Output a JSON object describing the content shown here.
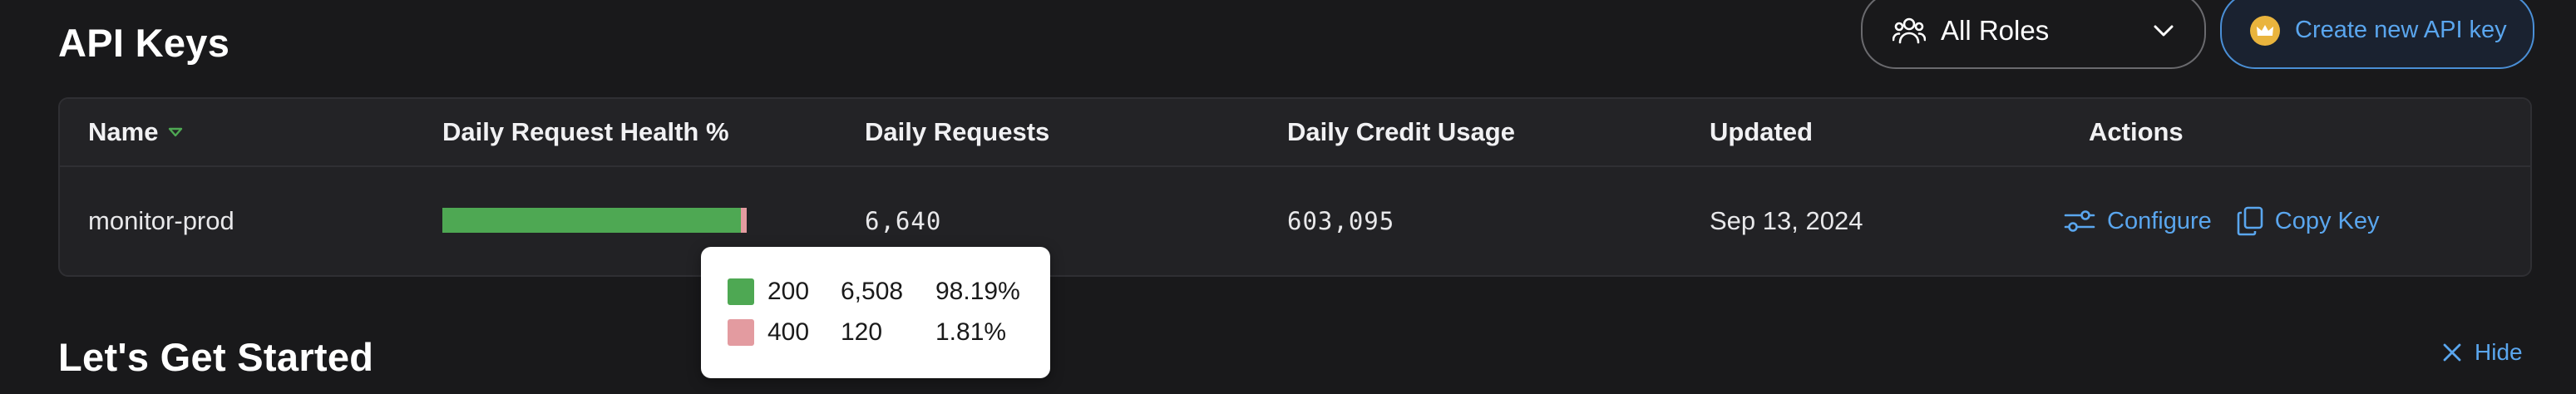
{
  "header": {
    "title": "API Keys",
    "roles_filter": {
      "label": "All Roles",
      "icon": "users-icon"
    },
    "create_button": {
      "label": "Create new API key",
      "icon": "crown-icon"
    }
  },
  "table": {
    "columns": [
      "Name",
      "Daily Request Health %",
      "Daily Requests",
      "Daily Credit Usage",
      "Updated",
      "Actions"
    ],
    "rows": [
      {
        "name": "monitor-prod",
        "health": {
          "ok_fraction": 0.9819,
          "error_fraction": 0.0181
        },
        "daily_requests": "6,640",
        "daily_credit_usage": "603,095",
        "updated": "Sep 13, 2024",
        "actions": {
          "configure": "Configure",
          "copy_key": "Copy Key"
        }
      }
    ]
  },
  "tooltip": {
    "rows": [
      {
        "code": "200",
        "count": "6,508",
        "percent": "98.19%",
        "color": "#4ea853"
      },
      {
        "code": "400",
        "count": "120",
        "percent": "1.81%",
        "color": "#e39ba0"
      }
    ]
  },
  "getting_started": {
    "title": "Let's Get Started",
    "hide_label": "Hide"
  },
  "colors": {
    "background": "#19191b",
    "accent": "#5aa6ee",
    "success": "#4ea853",
    "error": "#e39ba0",
    "crown": "#e9b43d"
  }
}
